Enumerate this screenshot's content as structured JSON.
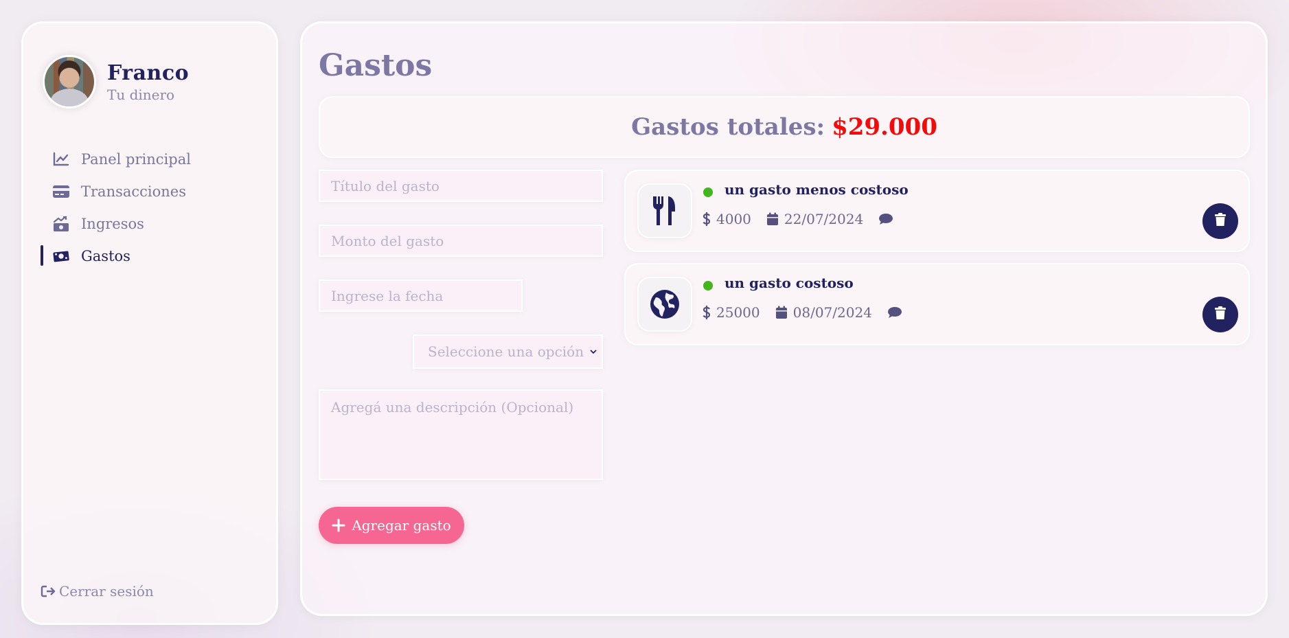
{
  "user": {
    "name": "Franco",
    "subtitle": "Tu dinero"
  },
  "nav": {
    "items": [
      {
        "label": "Panel principal",
        "icon": "chart-line-icon",
        "active": false
      },
      {
        "label": "Transacciones",
        "icon": "credit-card-icon",
        "active": false
      },
      {
        "label": "Ingresos",
        "icon": "money-bill-trend-up-icon",
        "active": false
      },
      {
        "label": "Gastos",
        "icon": "money-bill-icon",
        "active": true
      }
    ],
    "logout_label": "Cerrar sesión"
  },
  "page": {
    "title": "Gastos",
    "total_label": "Gastos totales:",
    "total_value": "$29.000"
  },
  "form": {
    "title_placeholder": "Título del gasto",
    "amount_placeholder": "Monto del gasto",
    "date_placeholder": "Ingrese la fecha",
    "select_label": "Seleccione una opción",
    "description_placeholder": "Agregá una descripción (Opcional)",
    "submit_label": "Agregar gasto"
  },
  "expenses": [
    {
      "title": "un gasto menos costoso",
      "amount": "4000",
      "date": "22/07/2024",
      "category_icon": "utensils-icon",
      "status_color": "#43b51d"
    },
    {
      "title": "un gasto costoso",
      "amount": "25000",
      "date": "08/07/2024",
      "category_icon": "globe-icon",
      "status_color": "#43b51d"
    }
  ],
  "colors": {
    "primary": "#222260",
    "accent": "#f56692",
    "total_value": "#f50a0a",
    "status": "#43b51d"
  }
}
